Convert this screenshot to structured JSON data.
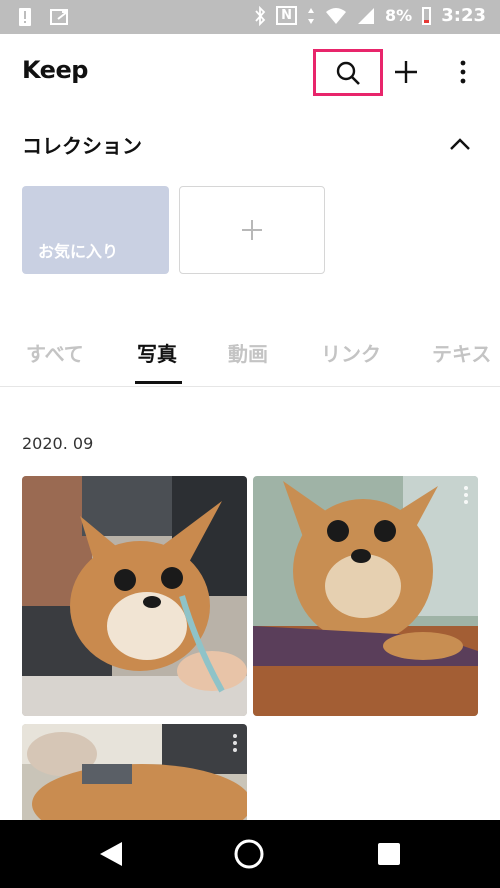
{
  "status_bar": {
    "battery": "8%",
    "time": "3:23",
    "nfc_label": "N"
  },
  "header": {
    "title": "Keep",
    "icons": [
      "search-icon",
      "plus-icon",
      "more-vertical-icon"
    ],
    "highlight_color": "#e8256b"
  },
  "collection": {
    "title": "コレクション",
    "favorite_label": "お気に入り",
    "add_symbol": "+",
    "favorite_color": "#c9d0e2"
  },
  "tabs": [
    {
      "label": "すべて",
      "active": false
    },
    {
      "label": "写真",
      "active": true
    },
    {
      "label": "動画",
      "active": false
    },
    {
      "label": "リンク",
      "active": false
    },
    {
      "label": "テキス",
      "active": false
    }
  ],
  "content": {
    "date": "2020. 09"
  },
  "nav": {
    "icons": [
      "back-icon",
      "home-icon",
      "recent-apps-icon"
    ]
  }
}
